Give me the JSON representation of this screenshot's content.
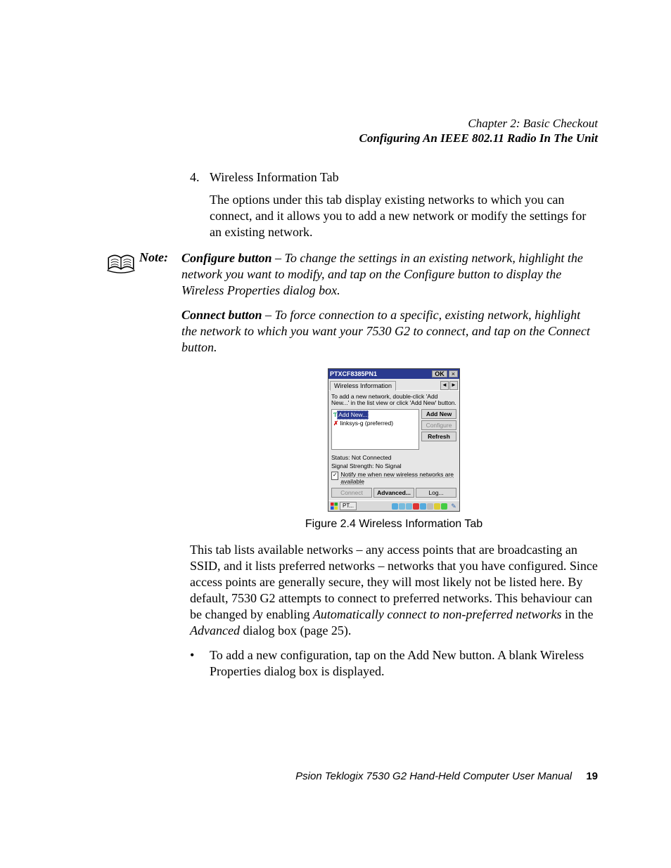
{
  "header": {
    "chapter": "Chapter 2: Basic Checkout",
    "section": "Configuring An IEEE 802.11 Radio In The Unit"
  },
  "item4": {
    "number": "4.",
    "title": "Wireless Information Tab",
    "para": "The options under this tab display existing networks to which you can connect, and it allows you to add a new network or modify the settings for an existing network."
  },
  "note": {
    "label": "Note:",
    "configure_lead": "Configure button",
    "configure_body": " – To change the settings in an existing network, highlight the network you want to modify, and tap on the Configure button to display the Wireless Properties dialog box.",
    "connect_lead": "Connect button",
    "connect_body": " – To force connection to a specific, existing network, highlight the network to which you want your 7530 G2 to connect, and tap on the Connect button."
  },
  "screenshot": {
    "title": "PTXCF8385PN1",
    "ok": "OK",
    "close": "×",
    "tab": "Wireless Information",
    "arrow_left": "◄",
    "arrow_right": "►",
    "hint": "To add a new network, double-click 'Add New...' in the list view or click 'Add New' button.",
    "list_item1": "Add New...",
    "list_item2": "linksys-g (preferred)",
    "btn_addnew": "Add New",
    "btn_configure": "Configure",
    "btn_refresh": "Refresh",
    "status": "Status:  Not Connected",
    "signal": "Signal Strength:  No Signal",
    "notify_check": "✓",
    "notify_label": "Notify me when new wireless networks are available",
    "btn_connect": "Connect",
    "btn_advanced": "Advanced...",
    "btn_log": "Log...",
    "task_label": "PT..."
  },
  "caption": "Figure 2.4 Wireless Information Tab",
  "para2_a": "This tab lists available networks – any access points that are broadcasting an SSID, and it lists preferred networks – networks that you have configured. Since access points are generally secure, they will most likely not be listed here. By default, 7530 G2 attempts to connect to preferred networks. This behaviour can be changed by enabling ",
  "para2_em1": "Automatically connect to non-preferred networks",
  "para2_b": " in the ",
  "para2_em2": "Advanced",
  "para2_c": " dialog box (page 25).",
  "bullet": {
    "dot": "•",
    "a": "To add a new configuration, tap on the ",
    "bold": "Add New",
    "b": " button. A blank ",
    "em": "Wireless Properties",
    "c": " dialog box is displayed."
  },
  "footer": {
    "text": "Psion Teklogix 7530 G2 Hand-Held Computer User Manual",
    "page": "19"
  }
}
